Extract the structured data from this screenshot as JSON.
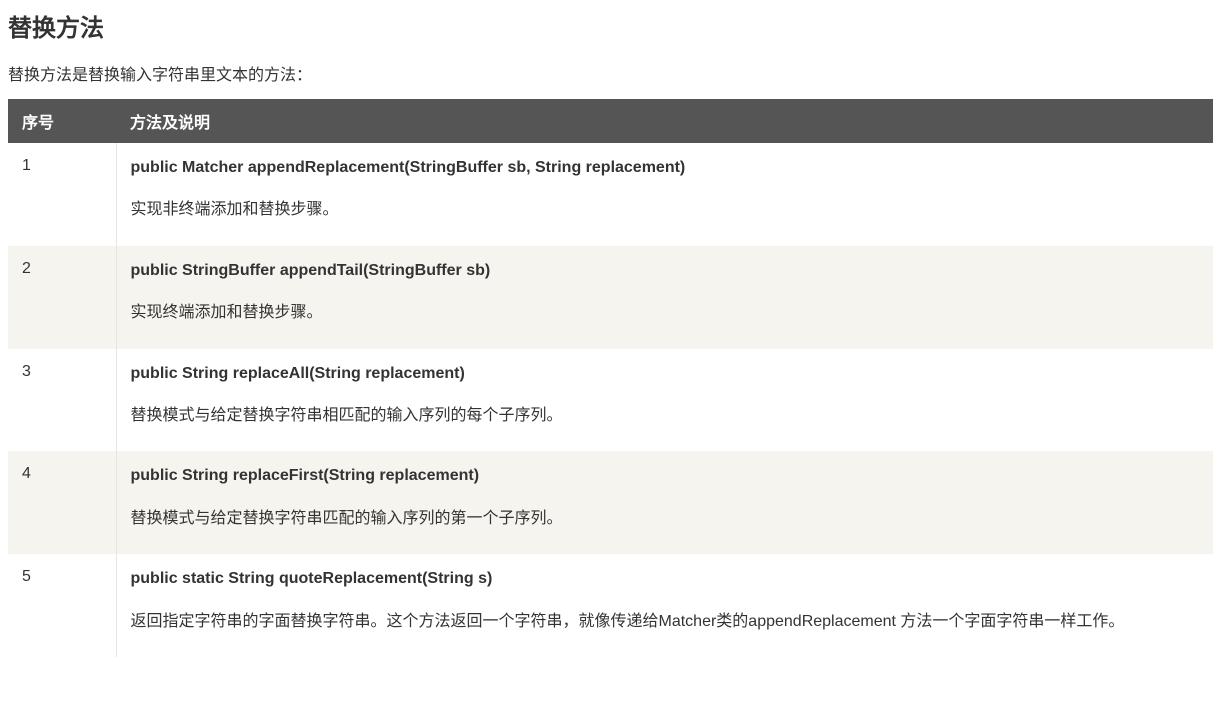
{
  "heading": "替换方法",
  "intro": "替换方法是替换输入字符串里文本的方法：",
  "table": {
    "headers": {
      "col1": "序号",
      "col2": "方法及说明"
    },
    "rows": [
      {
        "num": "1",
        "signature": "public Matcher appendReplacement(StringBuffer sb, String replacement)",
        "description": "实现非终端添加和替换步骤。"
      },
      {
        "num": "2",
        "signature": "public StringBuffer appendTail(StringBuffer sb)",
        "description": "实现终端添加和替换步骤。"
      },
      {
        "num": "3",
        "signature": "public String replaceAll(String replacement)",
        "description": " 替换模式与给定替换字符串相匹配的输入序列的每个子序列。"
      },
      {
        "num": "4",
        "signature": "public String replaceFirst(String replacement)",
        "description": " 替换模式与给定替换字符串匹配的输入序列的第一个子序列。"
      },
      {
        "num": "5",
        "signature": "public static String quoteReplacement(String s)",
        "description": "返回指定字符串的字面替换字符串。这个方法返回一个字符串，就像传递给Matcher类的appendReplacement 方法一个字面字符串一样工作。"
      }
    ]
  }
}
